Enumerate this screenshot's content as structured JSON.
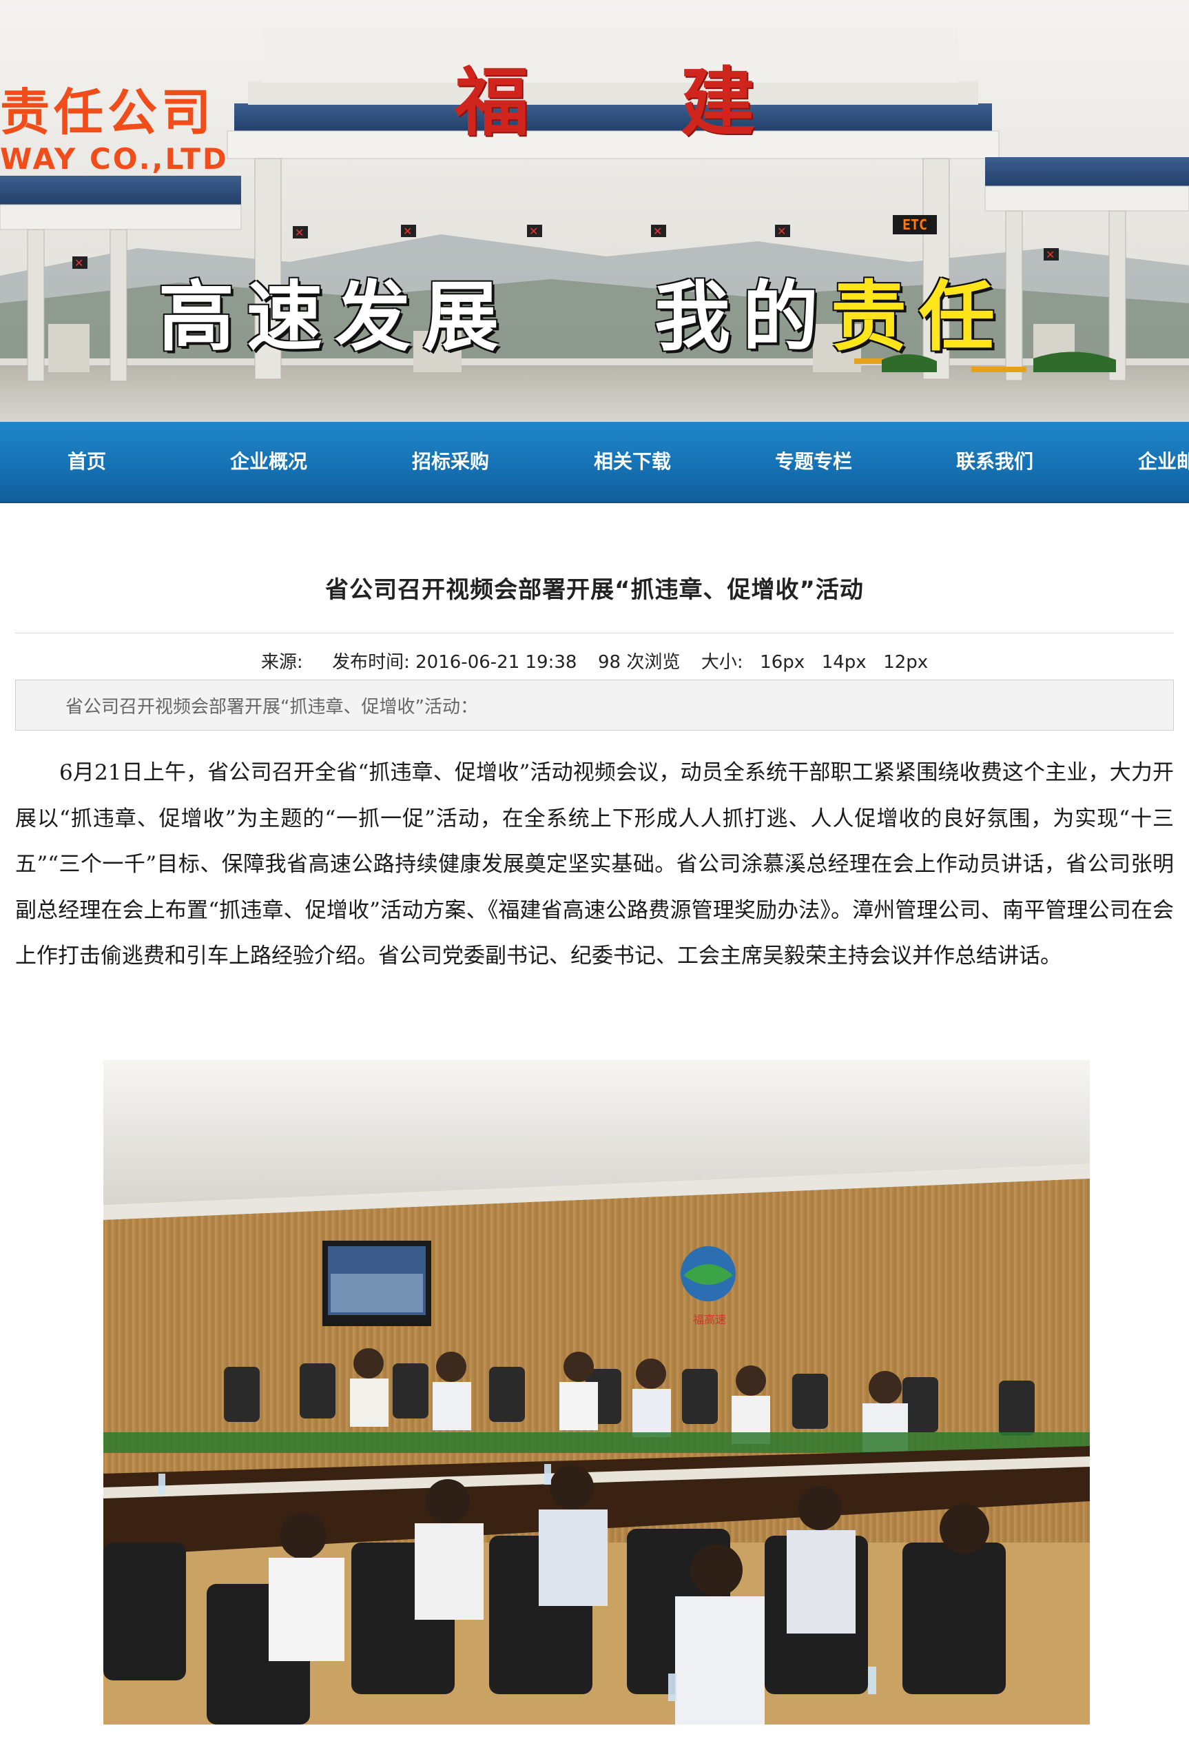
{
  "banner": {
    "company_name_partial": "责任公司",
    "company_name_en_partial": "WAY CO.,LTD",
    "gate_sign": "福建",
    "slogan_part1": "高速发展",
    "slogan_part2_prefix": "我的",
    "slogan_part2_highlight": "责任",
    "etc_label": "ETC"
  },
  "nav": {
    "items": [
      {
        "label": "首页"
      },
      {
        "label": "企业概况"
      },
      {
        "label": "招标采购"
      },
      {
        "label": "相关下载"
      },
      {
        "label": "专题专栏"
      },
      {
        "label": "联系我们"
      },
      {
        "label": "企业邮"
      }
    ]
  },
  "article": {
    "title": "省公司召开视频会部署开展“抓违章、促增收”活动",
    "meta": {
      "source_label": "来源:",
      "publish_label": "发布时间:",
      "publish_time": "2016-06-21 19:38",
      "views": "98",
      "views_label": "次浏览",
      "size_label": "大小:",
      "sizes": [
        "16px",
        "14px",
        "12px"
      ]
    },
    "summary": "省公司召开视频会部署开展“抓违章、促增收”活动：",
    "body": "6月21日上午，省公司召开全省“抓违章、促增收”活动视频会议，动员全系统干部职工紧紧围绕收费这个主业，大力开展以“抓违章、促增收”为主题的“一抓一促”活动，在全系统上下形成人人抓打逃、人人促增收的良好氛围，为实现“十三五”“三个一千”目标、保障我省高速公路持续健康发展奠定坚实基础。省公司涂慕溪总经理在会上作动员讲话，省公司张明副总经理在会上布置“抓违章、促增收”活动方案、《福建省高速公路费源管理奖励办法》。漳州管理公司、南平管理公司在会上作打击偷逃费和引车上路经验介绍。省公司党委副书记、纪委书记、工会主席吴毅荣主持会议并作总结讲话。",
    "photo_caption_sign": "福高速"
  }
}
